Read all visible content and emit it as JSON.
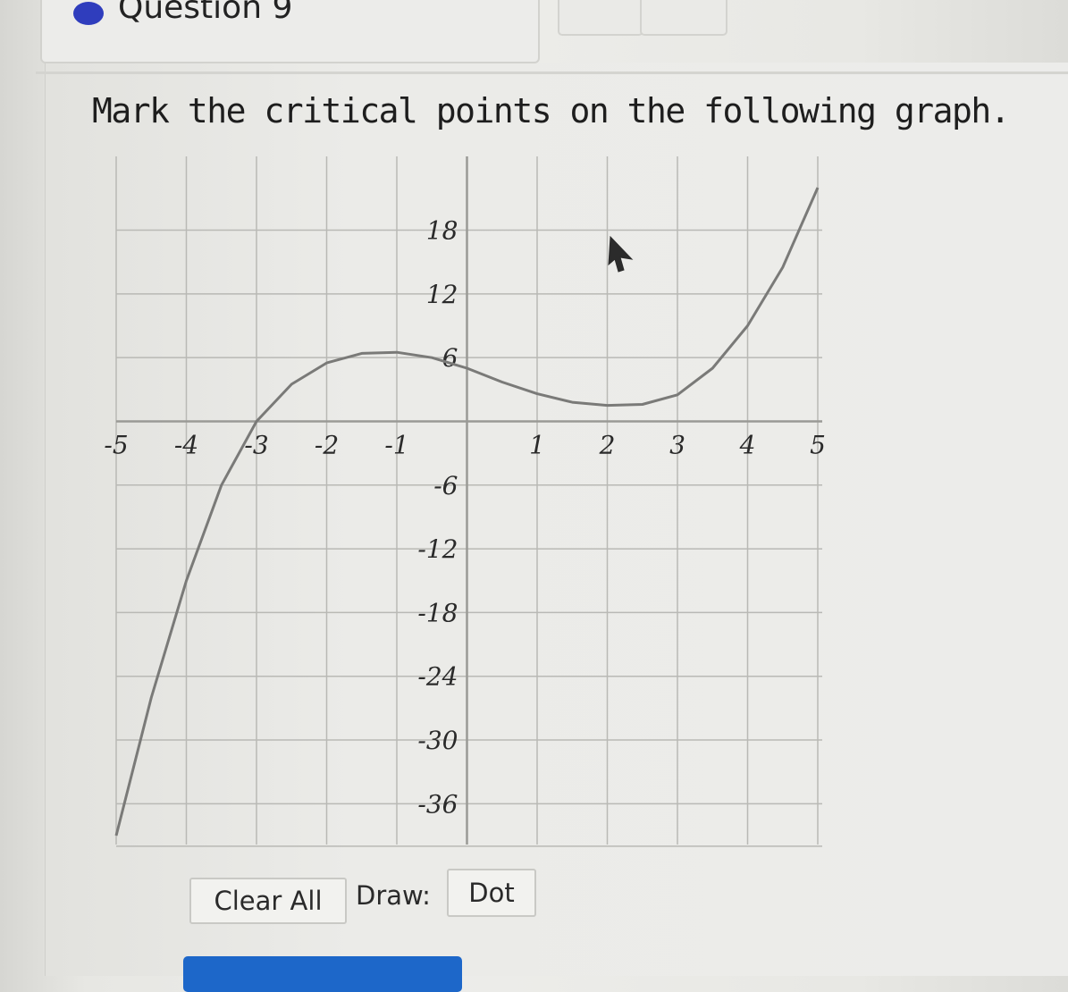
{
  "question": {
    "title": "Question 9"
  },
  "prompt": "Mark the critical points on the following graph.",
  "controls": {
    "clear_all": "Clear All",
    "draw_label": "Draw:",
    "draw_mode": "Dot"
  },
  "colors": {
    "question_dot": "#2f3dbd",
    "curve": "#7a7a78",
    "grid": "#b9b9b5",
    "axis": "#9a9a96",
    "submit": "#1d67c9"
  },
  "chart_data": {
    "type": "line",
    "xlim": [
      -5,
      5
    ],
    "ylim": [
      -36,
      18
    ],
    "x_ticks": [
      -5,
      -4,
      -3,
      -2,
      -1,
      1,
      2,
      3,
      4,
      5
    ],
    "x_tick_labels": [
      "-5",
      "-4",
      "-3",
      "-2",
      "-1",
      "1",
      "2",
      "3",
      "4",
      "5"
    ],
    "y_ticks": [
      18,
      12,
      6,
      -6,
      -12,
      -18,
      -24,
      -30,
      -36
    ],
    "y_tick_labels": [
      "18",
      "12",
      "6",
      "-6",
      "-12",
      "-18",
      "-24",
      "-30",
      "-36"
    ],
    "grid": true,
    "series": [
      {
        "x": [
          -5,
          -4.5,
          -4,
          -3.5,
          -3,
          -2.5,
          -2,
          -1.5,
          -1,
          -0.5,
          0,
          0.5,
          1,
          1.5,
          2,
          2.5,
          3,
          3.5,
          4,
          4.5,
          5
        ],
        "y": [
          -40,
          -26,
          -15,
          -6,
          0,
          3.5,
          5.5,
          6.4,
          6.5,
          6,
          5,
          3.7,
          2.6,
          1.8,
          1.5,
          1.6,
          2.5,
          5,
          9,
          14.5,
          22
        ]
      }
    ]
  }
}
